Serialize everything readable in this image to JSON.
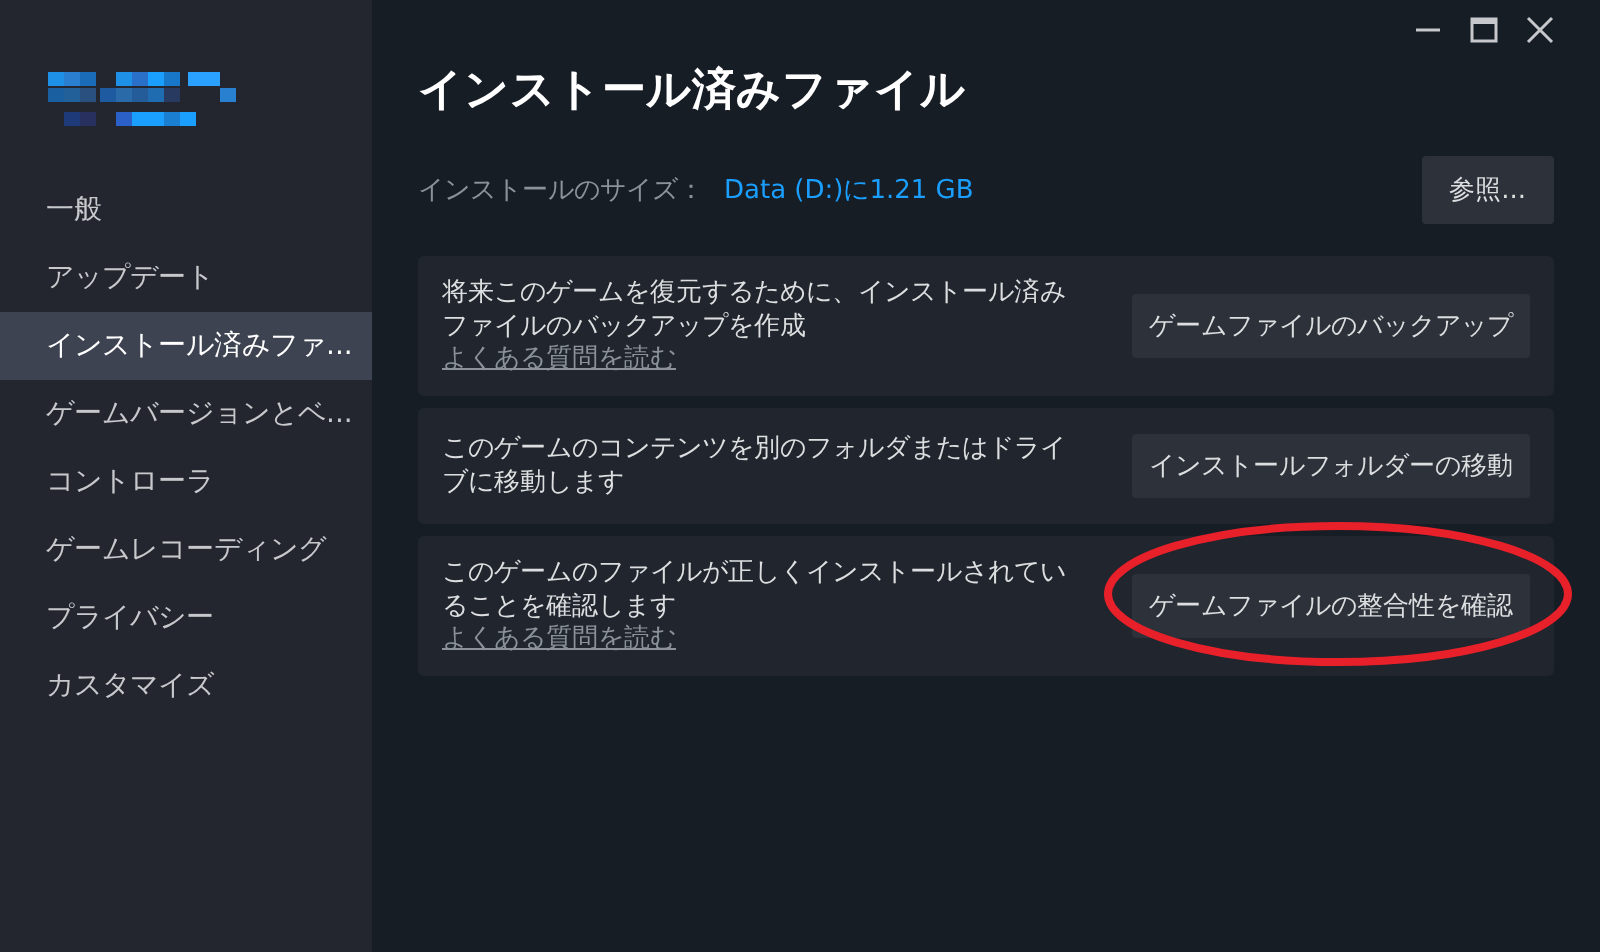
{
  "sidebar": {
    "items": [
      {
        "label": "一般",
        "selected": false
      },
      {
        "label": "アップデート",
        "selected": false
      },
      {
        "label": "インストール済みファ...",
        "selected": true
      },
      {
        "label": "ゲームバージョンとベ...",
        "selected": false
      },
      {
        "label": "コントローラ",
        "selected": false
      },
      {
        "label": "ゲームレコーディング",
        "selected": false
      },
      {
        "label": "プライバシー",
        "selected": false
      },
      {
        "label": "カスタマイズ",
        "selected": false
      }
    ]
  },
  "page": {
    "title": "インストール済みファイル",
    "size_label": "インストールのサイズ：",
    "size_value": "Data (D:)に1.21 GB",
    "browse_button": "参照..."
  },
  "actions": [
    {
      "description": "将来このゲームを復元するために、インストール済みファイルのバックアップを作成",
      "link": "よくある質問を読む",
      "button": "ゲームファイルのバックアップ",
      "highlighted": false
    },
    {
      "description": "このゲームのコンテンツを別のフォルダまたはドライブに移動します",
      "button": "インストールフォルダーの移動",
      "highlighted": false
    },
    {
      "description": "このゲームのファイルが正しくインストールされていることを確認します",
      "link": "よくある質問を読む",
      "button": "ゲームファイルの整合性を確認",
      "highlighted": true
    }
  ]
}
